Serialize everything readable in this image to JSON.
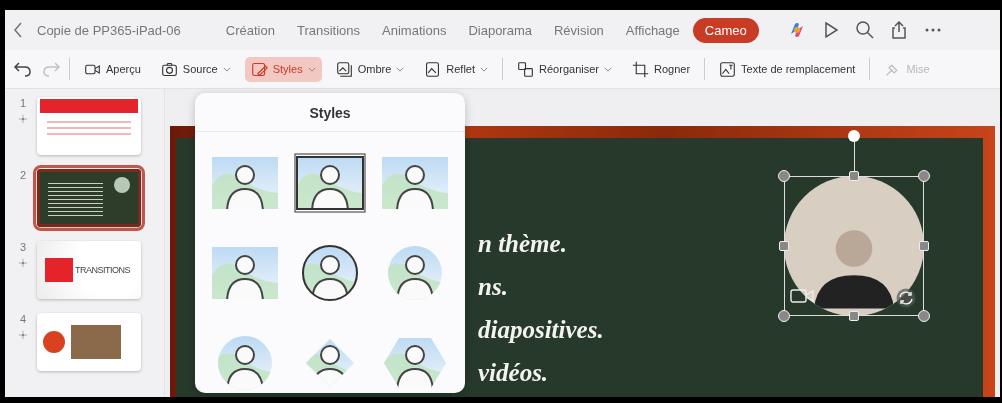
{
  "top_bar": {
    "title": "Copie de PP365-iPad-06",
    "tabs": [
      {
        "label": "Création",
        "selected": false
      },
      {
        "label": "Transitions",
        "selected": false
      },
      {
        "label": "Animations",
        "selected": false
      },
      {
        "label": "Diaporama",
        "selected": false
      },
      {
        "label": "Révision",
        "selected": false
      },
      {
        "label": "Affichage",
        "selected": false
      },
      {
        "label": "Cameo",
        "selected": true
      }
    ]
  },
  "toolbar": {
    "undo": {
      "disabled": false
    },
    "redo": {
      "disabled": true
    },
    "items": [
      {
        "label": "Aperçu",
        "dropdown": false,
        "selected": false,
        "disabled": false
      },
      {
        "label": "Source",
        "dropdown": true,
        "selected": false,
        "disabled": false
      },
      {
        "label": "Styles",
        "dropdown": true,
        "selected": true,
        "disabled": false
      },
      {
        "label": "Ombre",
        "dropdown": true,
        "selected": false,
        "disabled": false
      },
      {
        "label": "Reflet",
        "dropdown": true,
        "selected": false,
        "disabled": false
      },
      {
        "label": "Réorganiser",
        "dropdown": true,
        "selected": false,
        "disabled": false
      },
      {
        "label": "Rogner",
        "dropdown": false,
        "selected": false,
        "disabled": false
      },
      {
        "label": "Texte de remplacement",
        "dropdown": false,
        "selected": false,
        "disabled": false
      },
      {
        "label": "Mise",
        "dropdown": false,
        "selected": false,
        "disabled": true
      }
    ]
  },
  "slides": [
    {
      "number": "1",
      "selected": false,
      "transition": true,
      "kind": "title"
    },
    {
      "number": "2",
      "selected": true,
      "transition": false,
      "kind": "chalkboard"
    },
    {
      "number": "3",
      "selected": false,
      "transition": true,
      "kind": "transitions",
      "text": "TRANSITIONS"
    },
    {
      "number": "4",
      "selected": false,
      "transition": true,
      "kind": "photo"
    }
  ],
  "slide_text": [
    "n thème.",
    "ns.",
    "diapositives.",
    "vidéos."
  ],
  "camera": {
    "selected": true
  },
  "styles_popover": {
    "title": "Styles",
    "options": [
      {
        "kind": "rect-soft",
        "selected": false
      },
      {
        "kind": "rect-frame",
        "selected": true
      },
      {
        "kind": "rect-soft",
        "selected": false
      },
      {
        "kind": "rect-soft",
        "selected": false
      },
      {
        "kind": "circle-frame",
        "selected": false
      },
      {
        "kind": "circle-soft",
        "selected": false
      },
      {
        "kind": "circle-soft",
        "selected": false
      },
      {
        "kind": "diamond",
        "selected": false
      },
      {
        "kind": "hexagon",
        "selected": false
      }
    ]
  }
}
